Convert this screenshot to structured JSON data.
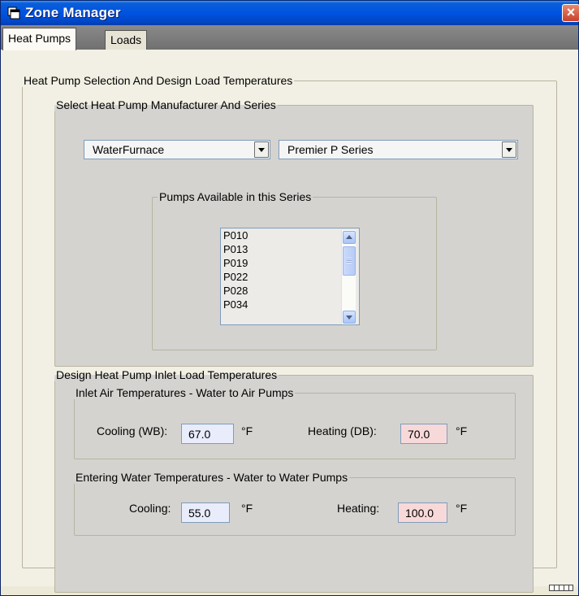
{
  "window": {
    "title": "Zone Manager",
    "close_glyph": "×"
  },
  "tabs": [
    {
      "label": "Heat Pumps",
      "active": true
    },
    {
      "label": "Loads",
      "active": false
    }
  ],
  "selection_group": {
    "legend": "Heat Pump Selection And Design Load Temperatures",
    "manufacturer_group": {
      "legend": "Select Heat Pump Manufacturer And Series",
      "manufacturer": "WaterFurnace",
      "series": "Premier P Series"
    },
    "pumps_group": {
      "legend": "Pumps Available in this Series",
      "items": [
        "P010",
        "P013",
        "P019",
        "P022",
        "P028",
        "P034"
      ]
    },
    "design_group": {
      "legend": "Design Heat Pump Inlet Load Temperatures",
      "air": {
        "legend": "Inlet Air Temperatures - Water to Air Pumps",
        "cooling_label": "Cooling (WB):",
        "cooling_value": "67.0",
        "heating_label": "Heating (DB):",
        "heating_value": "70.0",
        "unit": "°F"
      },
      "water": {
        "legend": "Entering Water Temperatures - Water to Water Pumps",
        "cooling_label": "Cooling:",
        "cooling_value": "55.0",
        "heating_label": "Heating:",
        "heating_value": "100.0",
        "unit": "°F"
      }
    }
  },
  "colors": {
    "titlebar": "#0053e1",
    "cool_field": "#e9ecfb",
    "heat_field": "#f8d9d9"
  }
}
